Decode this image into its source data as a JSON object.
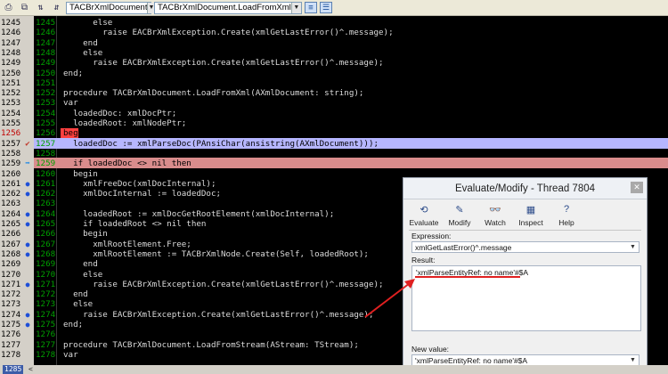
{
  "toolbar": {
    "class_combo": "TACBrXmlDocument",
    "method_combo": "TACBrXmlDocument.LoadFromXml"
  },
  "rows": [
    {
      "out": "1245",
      "in": "1245",
      "code": "      else",
      "mark": ""
    },
    {
      "out": "1246",
      "in": "1246",
      "code": "        raise EACBrXmlException.Create(xmlGetLastError()^.message);",
      "mark": ""
    },
    {
      "out": "1247",
      "in": "1247",
      "code": "    end",
      "mark": ""
    },
    {
      "out": "1248",
      "in": "1248",
      "code": "    else",
      "mark": ""
    },
    {
      "out": "1249",
      "in": "1249",
      "code": "      raise EACBrXmlException.Create(xmlGetLastError()^.message);",
      "mark": ""
    },
    {
      "out": "1250",
      "in": "1250",
      "code": "end;",
      "mark": ""
    },
    {
      "out": "1251",
      "in": "1251",
      "code": "",
      "mark": ""
    },
    {
      "out": "1252",
      "in": "1252",
      "code": "procedure TACBrXmlDocument.LoadFromXml(AXmlDocument: string);",
      "mark": ""
    },
    {
      "out": "1253",
      "in": "1253",
      "code": "var",
      "mark": ""
    },
    {
      "out": "1254",
      "in": "1254",
      "code": "  loadedDoc: xmlDocPtr;",
      "mark": ""
    },
    {
      "out": "1255",
      "in": "1255",
      "code": "  loadedRoot: xmlNodePtr;",
      "mark": ""
    },
    {
      "out": "1256",
      "in": "1256",
      "code": "begin",
      "mark": ""
    },
    {
      "out": "1257",
      "in": "1257",
      "code": "  loadedDoc := xmlParseDoc(PAnsiChar(ansistring(AXmlDocument)));",
      "mark": "bp"
    },
    {
      "out": "1258",
      "in": "1258",
      "code": "",
      "mark": ""
    },
    {
      "out": "1259",
      "in": "1259",
      "code": "  if loadedDoc <> nil then",
      "mark": "arrow"
    },
    {
      "out": "1260",
      "in": "1260",
      "code": "  begin",
      "mark": ""
    },
    {
      "out": "1261",
      "in": "1261",
      "code": "    xmlFreeDoc(xmlDocInternal);",
      "mark": "dot"
    },
    {
      "out": "1262",
      "in": "1262",
      "code": "    xmlDocInternal := loadedDoc;",
      "mark": "dot"
    },
    {
      "out": "1263",
      "in": "1263",
      "code": "",
      "mark": ""
    },
    {
      "out": "1264",
      "in": "1264",
      "code": "    loadedRoot := xmlDocGetRootElement(xmlDocInternal);",
      "mark": "dot"
    },
    {
      "out": "1265",
      "in": "1265",
      "code": "    if loadedRoot <> nil then",
      "mark": "dot"
    },
    {
      "out": "1266",
      "in": "1266",
      "code": "    begin",
      "mark": ""
    },
    {
      "out": "1267",
      "in": "1267",
      "code": "      xmlRootElement.Free;",
      "mark": "dot"
    },
    {
      "out": "1268",
      "in": "1268",
      "code": "      xmlRootElement := TACBrXmlNode.Create(Self, loadedRoot);",
      "mark": "dot"
    },
    {
      "out": "1269",
      "in": "1269",
      "code": "    end",
      "mark": ""
    },
    {
      "out": "1270",
      "in": "1270",
      "code": "    else",
      "mark": ""
    },
    {
      "out": "1271",
      "in": "1271",
      "code": "      raise EACBrXmlException.Create(xmlGetLastError()^.message);",
      "mark": "dot"
    },
    {
      "out": "1272",
      "in": "1272",
      "code": "  end",
      "mark": ""
    },
    {
      "out": "1273",
      "in": "1273",
      "code": "  else",
      "mark": ""
    },
    {
      "out": "1274",
      "in": "1274",
      "code": "    raise EACBrXmlException.Create(xmlGetLastError()^.message);",
      "mark": "dot"
    },
    {
      "out": "1275",
      "in": "1275",
      "code": "end;",
      "mark": "dot"
    },
    {
      "out": "1276",
      "in": "1276",
      "code": "",
      "mark": ""
    },
    {
      "out": "1277",
      "in": "1277",
      "code": "procedure TACBrXmlDocument.LoadFromStream(AStream: TStream);",
      "mark": ""
    },
    {
      "out": "1278",
      "in": "1278",
      "code": "var",
      "mark": ""
    }
  ],
  "dialog": {
    "title": "Evaluate/Modify - Thread 7804",
    "tools": [
      "Evaluate",
      "Modify",
      "Watch",
      "Inspect",
      "Help"
    ],
    "expression_label": "Expression:",
    "expression_value": "xmlGetLastError()^.message",
    "result_label": "Result:",
    "result_value": "'xmlParseEntityRef: no name'#$A",
    "new_value_label": "New value:",
    "new_value": "'xmlParseEntityRef: no name'#$A"
  },
  "status": {
    "line_indicator": "1285"
  },
  "colors": {
    "exec_line": "#b6b6ff",
    "breakpoint_line": "#d98c8c",
    "annotation": "#e02020",
    "line_numbers": "#00a000"
  }
}
